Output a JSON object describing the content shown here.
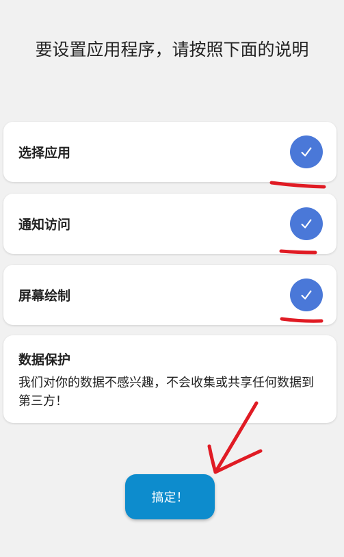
{
  "title": "要设置应用程序，请按照下面的说明",
  "steps": [
    {
      "label": "选择应用",
      "status_icon": "check-icon"
    },
    {
      "label": "通知访问",
      "status_icon": "check-icon"
    },
    {
      "label": "屏幕绘制",
      "status_icon": "check-icon"
    }
  ],
  "privacy": {
    "title": "数据保护",
    "text": "我们对你的数据不感兴趣，不会收集或共享任何数据到第三方！"
  },
  "done_button": {
    "label": "搞定！"
  },
  "colors": {
    "check_blue": "#4a78d8",
    "button_blue": "#0d8ccd",
    "annotation_red": "#e01b24"
  }
}
